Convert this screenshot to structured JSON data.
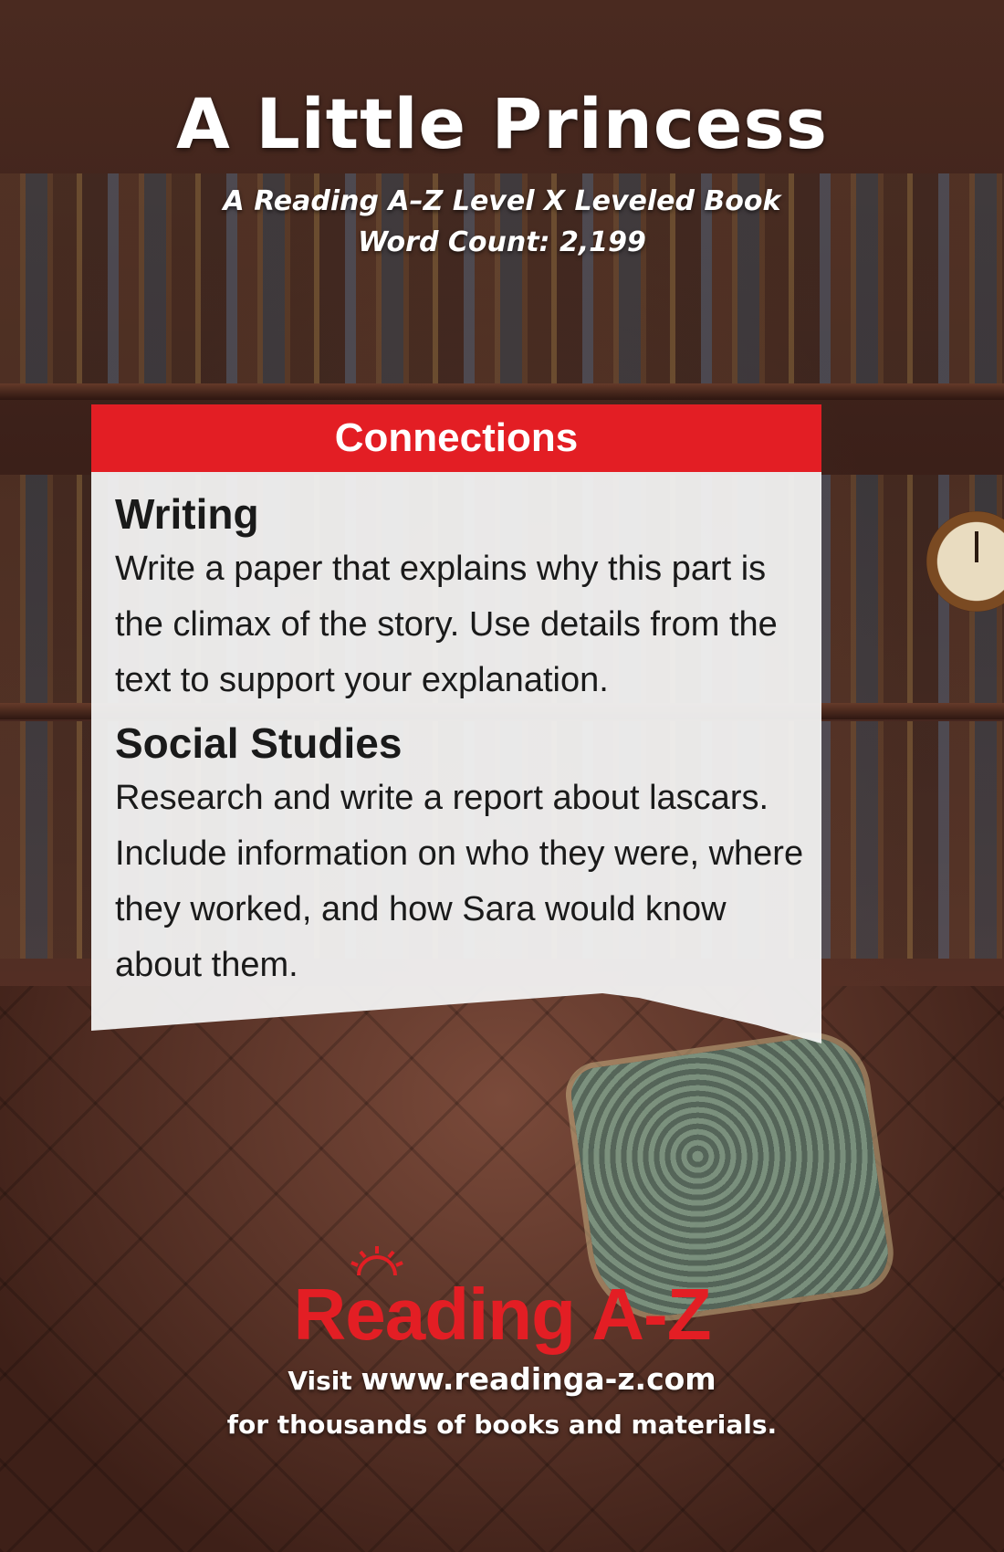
{
  "cover": {
    "title": "A Little Princess",
    "subtitle_line1": "A Reading A–Z Level X Leveled Book",
    "subtitle_line2": "Word Count: 2,199"
  },
  "connections": {
    "header": "Connections",
    "sections": [
      {
        "heading": "Writing",
        "text": "Write a paper that explains why this part is the climax of the story. Use details from the text to support your explanation."
      },
      {
        "heading": "Social Studies",
        "text": "Research and write a report about lascars. Include information on who they were, where they worked, and how Sara would know about them."
      }
    ]
  },
  "footer": {
    "logo": "Reading A-Z",
    "visit_prefix": "Visit",
    "url": "www.readinga-z.com",
    "tagline": "for thousands of books and materials."
  },
  "colors": {
    "accent_red": "#e31e24",
    "panel_bg": "#f2f2f2",
    "title_text": "#ffffff"
  }
}
